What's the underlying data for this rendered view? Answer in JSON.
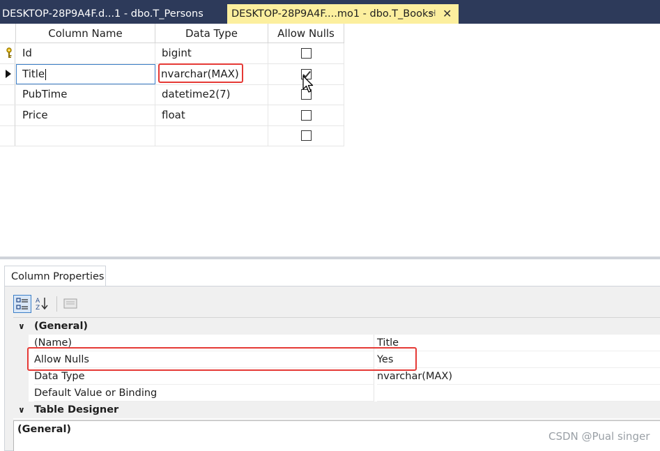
{
  "tabs": {
    "inactive_label": "DESKTOP-28P9A4F.d...1 - dbo.T_Persons",
    "active_label": "DESKTOP-28P9A4F....mo1 - dbo.T_Books",
    "pin_glyph": "⊣",
    "close_glyph": "✕"
  },
  "designer": {
    "headers": {
      "column_name": "Column Name",
      "data_type": "Data Type",
      "allow_nulls": "Allow Nulls"
    },
    "rows": [
      {
        "name": "Id",
        "type": "bigint",
        "allow_nulls": false,
        "primary_key": true
      },
      {
        "name": "Title",
        "type": "nvarchar(MAX)",
        "allow_nulls": true,
        "editing": true
      },
      {
        "name": "PubTime",
        "type": "datetime2(7)",
        "allow_nulls": false
      },
      {
        "name": "Price",
        "type": "float",
        "allow_nulls": false
      },
      {
        "name": "",
        "type": "",
        "allow_nulls": false
      }
    ]
  },
  "properties": {
    "tab_label": "Column Properties",
    "categories": [
      {
        "label": "(General)"
      },
      {
        "label": "Table Designer"
      }
    ],
    "items": [
      {
        "name": "(Name)",
        "value": "Title"
      },
      {
        "name": "Allow Nulls",
        "value": "Yes"
      },
      {
        "name": "Data Type",
        "value": "nvarchar(MAX)"
      },
      {
        "name": "Default Value or Binding",
        "value": ""
      }
    ],
    "description_title": "(General)"
  },
  "watermark": "CSDN @Pual singer",
  "colors": {
    "tabstrip": "#2d3a5a",
    "active_tab": "#fcef9e",
    "highlight_red": "#e53935",
    "selection_blue": "#3c7fc8"
  }
}
